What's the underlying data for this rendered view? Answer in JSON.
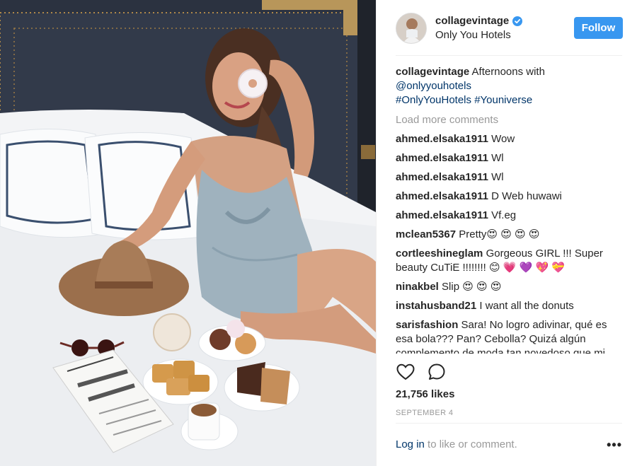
{
  "post": {
    "image_description": "",
    "header": {
      "username": "collagevintage",
      "location": "Only You Hotels",
      "verified": true,
      "follow_label": "Follow"
    },
    "caption": {
      "username": "collagevintage",
      "text": "Afternoons with",
      "mention": "@onlyyouhotels",
      "hashtag1": "#OnlyYouHotels",
      "hashtag2": "#Youniverse"
    },
    "load_more": "Load more comments",
    "comments": [
      {
        "user": "ahmed.elsaka1911",
        "text": "Wow"
      },
      {
        "user": "ahmed.elsaka1911",
        "text": "Wl"
      },
      {
        "user": "ahmed.elsaka1911",
        "text": "Wl"
      },
      {
        "user": "ahmed.elsaka1911",
        "text": "D Web huwawi"
      },
      {
        "user": "ahmed.elsaka1911",
        "text": "Vf.eg"
      },
      {
        "user": "mclean5367",
        "text": "Pretty😍 😍 😍 😍"
      },
      {
        "user": "cortleeshineglam",
        "text": "Gorgeous GIRL !!! Super beauty CuTiE !!!!!!!! 😊 💗 💜 💖 💝"
      },
      {
        "user": "ninakbel",
        "text": "Slip 😍 😍 😍"
      },
      {
        "user": "instahusband21",
        "text": "I want all the donuts"
      },
      {
        "user": "sarisfashion",
        "text": "Sara! No logro adivinar, qué es esa bola??? Pan? Cebolla? Quizá algún complemento de moda tan novedoso que mi"
      }
    ],
    "likes": "21,756 likes",
    "date": "SEPTEMBER 4",
    "footer": {
      "login_link": "Log in",
      "login_text": " to like or comment.",
      "more": "•••"
    },
    "icons": {
      "like": "heart-icon",
      "comment": "comment-bubble-icon",
      "verified": "verified-badge-icon",
      "more": "more-options-icon"
    },
    "colors": {
      "follow_button": "#3897f0",
      "link": "#003569",
      "muted": "#999999",
      "verified": "#3897f0"
    }
  }
}
